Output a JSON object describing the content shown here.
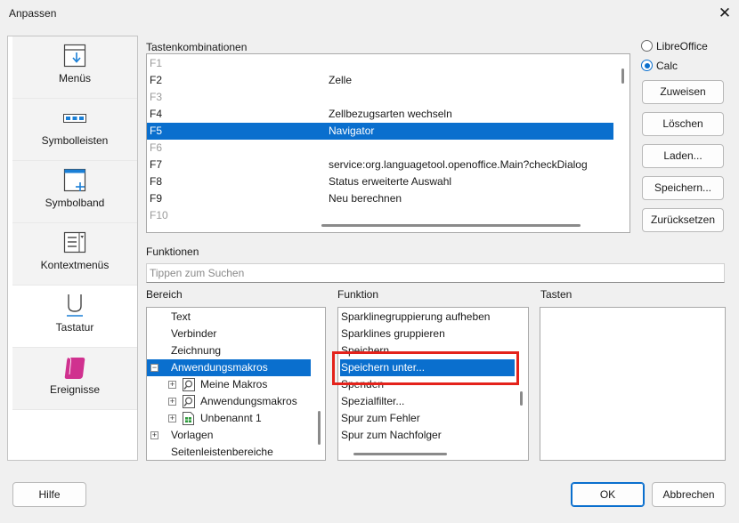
{
  "window": {
    "title": "Anpassen"
  },
  "sidebar": {
    "items": [
      {
        "label": "Menüs",
        "icon": "menu-icon"
      },
      {
        "label": "Symbolleisten",
        "icon": "toolbar-icon"
      },
      {
        "label": "Symbolband",
        "icon": "notebookbar-icon"
      },
      {
        "label": "Kontextmenüs",
        "icon": "context-menu-icon"
      },
      {
        "label": "Tastatur",
        "icon": "keyboard-icon",
        "selected": true
      },
      {
        "label": "Ereignisse",
        "icon": "events-scroll-icon"
      }
    ]
  },
  "shortcuts": {
    "label": "Tastenkombinationen",
    "rows": [
      {
        "key": "F1",
        "function": ""
      },
      {
        "key": "F2",
        "function": "Zelle"
      },
      {
        "key": "F3",
        "function": ""
      },
      {
        "key": "F4",
        "function": "Zellbezugsarten wechseln"
      },
      {
        "key": "F5",
        "function": "Navigator"
      },
      {
        "key": "F6",
        "function": ""
      },
      {
        "key": "F7",
        "function": "service:org.languagetool.openoffice.Main?checkDialog"
      },
      {
        "key": "F8",
        "function": "Status erweiterte Auswahl"
      },
      {
        "key": "F9",
        "function": "Neu berechnen"
      },
      {
        "key": "F10",
        "function": ""
      }
    ],
    "selected_key": "F5"
  },
  "scope": {
    "options": [
      {
        "label": "LibreOffice",
        "checked": false
      },
      {
        "label": "Calc",
        "checked": true
      }
    ]
  },
  "actions": {
    "assign": "Zuweisen",
    "delete": "Löschen",
    "load": "Laden...",
    "save": "Speichern...",
    "reset": "Zurücksetzen"
  },
  "functions": {
    "label": "Funktionen",
    "search_placeholder": "Tippen zum Suchen"
  },
  "category": {
    "label": "Bereich",
    "items": [
      {
        "label": "Text",
        "level": 0,
        "expander": ""
      },
      {
        "label": "Verbinder",
        "level": 0,
        "expander": ""
      },
      {
        "label": "Zeichnung",
        "level": 0,
        "expander": ""
      },
      {
        "label": "Anwendungsmakros",
        "level": 0,
        "expander": "minus",
        "selected": true
      },
      {
        "label": "Meine Makros",
        "level": 1,
        "expander": "plus",
        "icon": "macro-library-icon"
      },
      {
        "label": "Anwendungsmakros",
        "level": 1,
        "expander": "plus",
        "icon": "macro-library-icon"
      },
      {
        "label": "Unbenannt 1",
        "level": 1,
        "expander": "plus",
        "icon": "spreadsheet-document-icon"
      },
      {
        "label": "Vorlagen",
        "level": 0,
        "expander": "plus"
      },
      {
        "label": "Seitenleistenbereiche",
        "level": 0,
        "expander": ""
      }
    ]
  },
  "function_list": {
    "label": "Funktion",
    "items": [
      "Sparklinegruppierung aufheben",
      "Sparklines gruppieren",
      "Speichern",
      "Speichern unter...",
      "Spenden",
      "Spezialfilter...",
      "Spur zum Fehler",
      "Spur zum Nachfolger"
    ],
    "selected_index": 3
  },
  "keys": {
    "label": "Tasten"
  },
  "footer": {
    "help": "Hilfe",
    "ok": "OK",
    "cancel": "Abbrechen"
  },
  "colors": {
    "selection": "#0a6fce",
    "highlight_box": "#e4221b"
  }
}
